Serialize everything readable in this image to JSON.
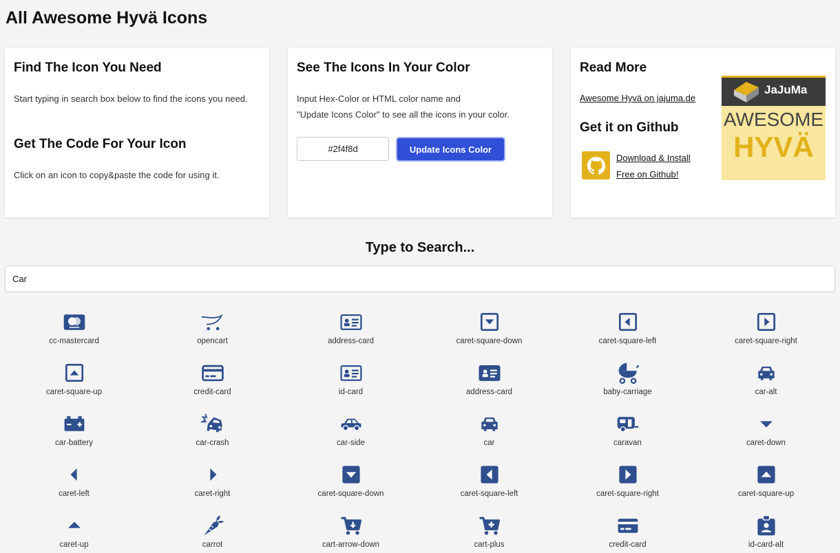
{
  "page": {
    "title": "All Awesome Hyvä Icons"
  },
  "colors": {
    "icon": "#2f4f8d",
    "button": "#2f4fd6",
    "accent": "#e3b11a"
  },
  "card_find": {
    "title": "Find The Icon You Need",
    "text": "Start typing in search box below to find the icons you need.",
    "code_title": "Get The Code For Your Icon",
    "code_text": "Click on an icon to copy&paste the code for using it."
  },
  "card_color": {
    "title": "See The Icons In Your Color",
    "text_line1": "Input Hex-Color or HTML color name and",
    "text_line2": "\"Update Icons Color\" to see all the icons in your color.",
    "hex_value": "#2f4f8d",
    "button_label": "Update Icons Color"
  },
  "card_read": {
    "title": "Read More",
    "link": "Awesome Hyvä on jajuma.de",
    "github_title": "Get it on Github",
    "github_link_line1": "Download & Install",
    "github_link_line2": "Free on Github!",
    "logo_brand": "JaJuMa",
    "logo_line1": "AWESOME",
    "logo_line2": "HYVÄ"
  },
  "search": {
    "heading": "Type to Search...",
    "value": "Car"
  },
  "icons": [
    {
      "label": "cc-mastercard",
      "icon": "cc-mastercard-icon"
    },
    {
      "label": "opencart",
      "icon": "opencart-icon"
    },
    {
      "label": "address-card",
      "icon": "address-card-icon"
    },
    {
      "label": "caret-square-down",
      "icon": "caret-square-down-icon"
    },
    {
      "label": "caret-square-left",
      "icon": "caret-square-left-icon"
    },
    {
      "label": "caret-square-right",
      "icon": "caret-square-right-icon"
    },
    {
      "label": "caret-square-up",
      "icon": "caret-square-up-icon"
    },
    {
      "label": "credit-card",
      "icon": "credit-card-icon"
    },
    {
      "label": "id-card",
      "icon": "id-card-icon"
    },
    {
      "label": "address-card",
      "icon": "address-card-solid-icon"
    },
    {
      "label": "baby-carriage",
      "icon": "baby-carriage-icon"
    },
    {
      "label": "car-alt",
      "icon": "car-alt-icon"
    },
    {
      "label": "car-battery",
      "icon": "car-battery-icon"
    },
    {
      "label": "car-crash",
      "icon": "car-crash-icon"
    },
    {
      "label": "car-side",
      "icon": "car-side-icon"
    },
    {
      "label": "car",
      "icon": "car-icon"
    },
    {
      "label": "caravan",
      "icon": "caravan-icon"
    },
    {
      "label": "caret-down",
      "icon": "caret-down-icon"
    },
    {
      "label": "caret-left",
      "icon": "caret-left-icon"
    },
    {
      "label": "caret-right",
      "icon": "caret-right-icon"
    },
    {
      "label": "caret-square-down",
      "icon": "caret-square-down-solid-icon"
    },
    {
      "label": "caret-square-left",
      "icon": "caret-square-left-solid-icon"
    },
    {
      "label": "caret-square-right",
      "icon": "caret-square-right-solid-icon"
    },
    {
      "label": "caret-square-up",
      "icon": "caret-square-up-solid-icon"
    },
    {
      "label": "caret-up",
      "icon": "caret-up-icon"
    },
    {
      "label": "carrot",
      "icon": "carrot-icon"
    },
    {
      "label": "cart-arrow-down",
      "icon": "cart-arrow-down-icon"
    },
    {
      "label": "cart-plus",
      "icon": "cart-plus-icon"
    },
    {
      "label": "credit-card",
      "icon": "credit-card-solid-icon"
    },
    {
      "label": "id-card-alt",
      "icon": "id-card-alt-icon"
    }
  ]
}
